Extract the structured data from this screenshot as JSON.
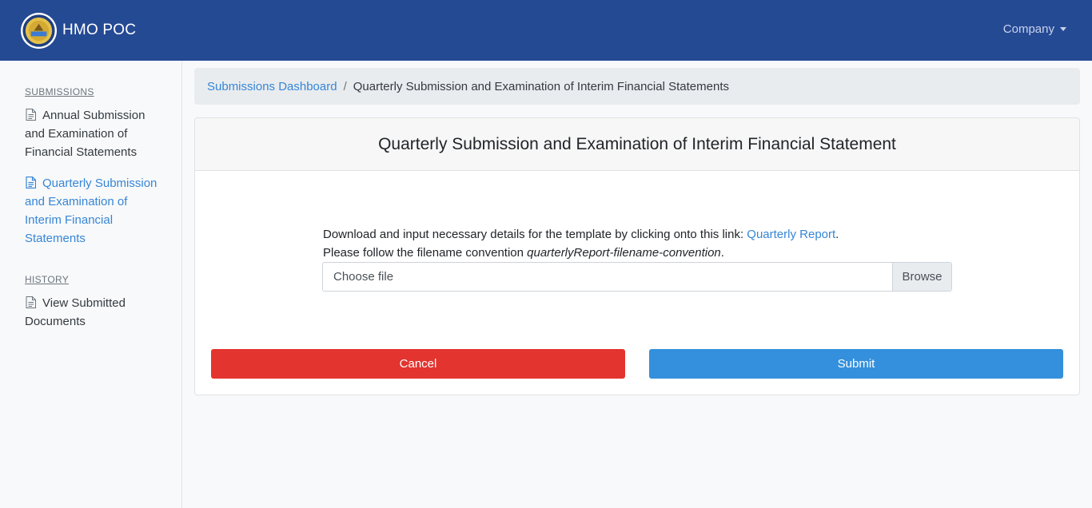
{
  "navbar": {
    "brand": "HMO POC",
    "logo_icon": "commission-seal-logo",
    "company_label": "Company"
  },
  "sidebar": {
    "submissions_heading": "SUBMISSIONS",
    "items": [
      {
        "label": "Annual Submission and Examination of Financial Statements",
        "icon": "document-icon",
        "active": false
      },
      {
        "label": "Quarterly Submission and Examination of Interim Financial Statements",
        "icon": "document-icon",
        "active": true
      }
    ],
    "history_heading": "HISTORY",
    "history_items": [
      {
        "label": "View Submitted Documents",
        "icon": "document-icon",
        "active": false
      }
    ]
  },
  "breadcrumb": {
    "link": "Submissions Dashboard",
    "separator": "/",
    "current": "Quarterly Submission and Examination of Interim Financial Statements"
  },
  "card": {
    "title": "Quarterly Submission and Examination of Interim Financial Statement",
    "instruction_prefix": "Download and input necessary details for the template by clicking onto this link: ",
    "instruction_link": "Quarterly Report",
    "instruction_suffix": ".",
    "convention_prefix": "Please follow the filename convention ",
    "convention_name": "quarterlyReport-filename-convention",
    "convention_suffix": ".",
    "file_placeholder": "Choose file",
    "browse_label": "Browse",
    "cancel_label": "Cancel",
    "submit_label": "Submit"
  },
  "colors": {
    "navbar": "#254a94",
    "link": "#3686d6",
    "cancel": "#e3342f",
    "submit": "#3490dc"
  }
}
